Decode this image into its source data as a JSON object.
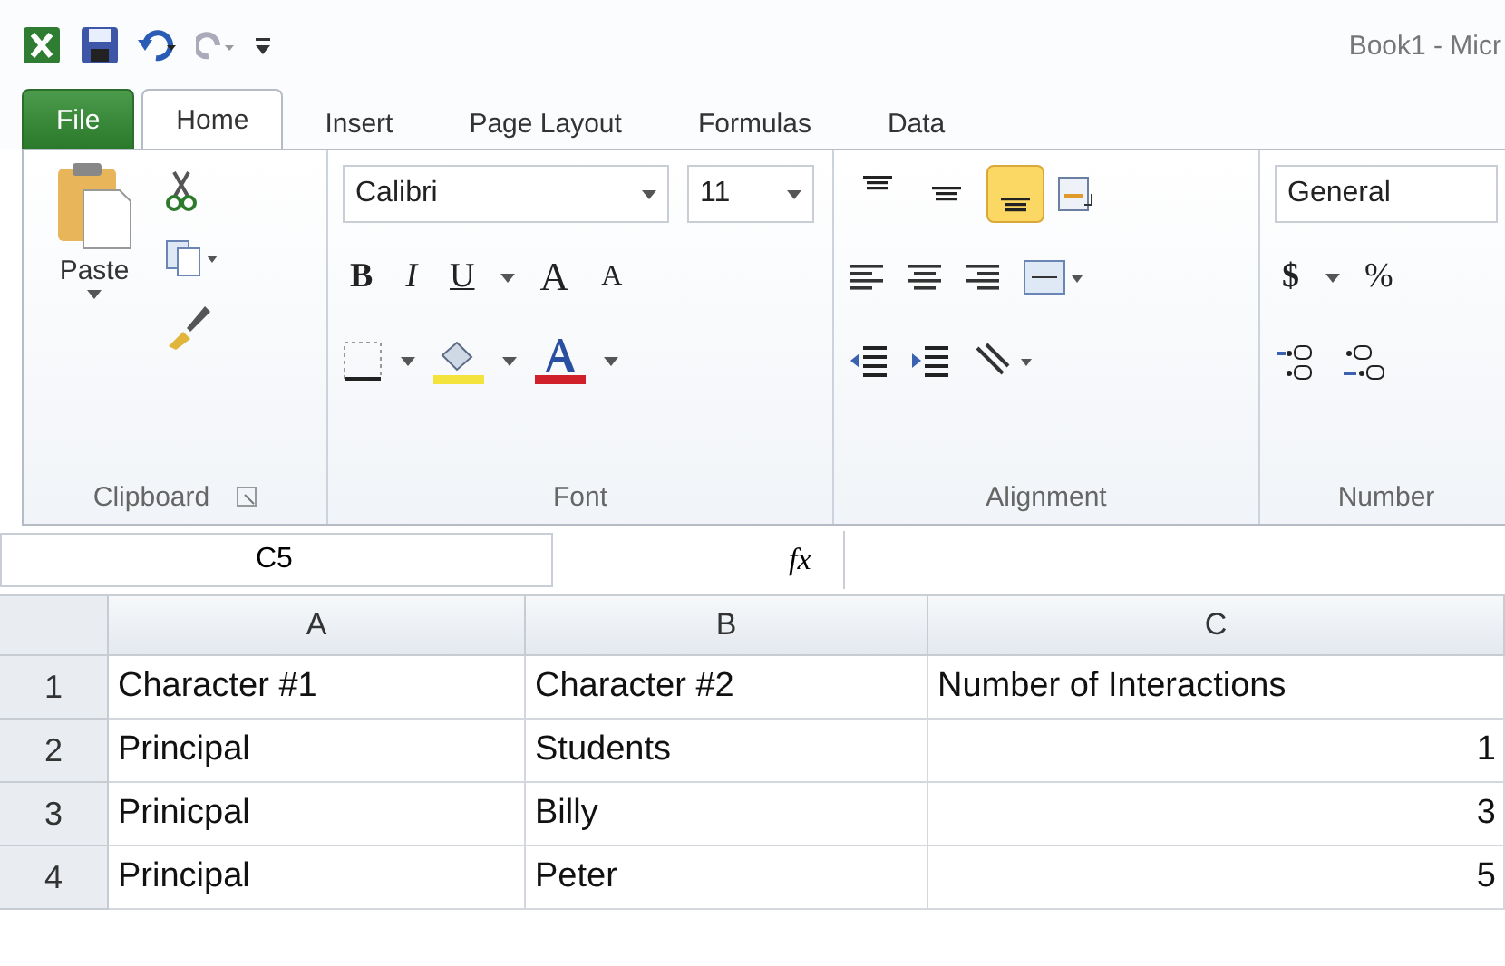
{
  "window": {
    "title": "Book1 - Micr"
  },
  "tabs": [
    {
      "label": "File",
      "kind": "file",
      "selected": false
    },
    {
      "label": "Home",
      "kind": "tab",
      "selected": true
    },
    {
      "label": "Insert",
      "kind": "tab",
      "selected": false
    },
    {
      "label": "Page Layout",
      "kind": "tab",
      "selected": false
    },
    {
      "label": "Formulas",
      "kind": "tab",
      "selected": false
    },
    {
      "label": "Data",
      "kind": "tab",
      "selected": false
    }
  ],
  "ribbon": {
    "clipboard": {
      "label": "Clipboard",
      "paste": "Paste"
    },
    "font": {
      "label": "Font",
      "name": "Calibri",
      "size": "11",
      "bold": "B",
      "italic": "I",
      "underline": "U",
      "grow": "A",
      "shrink": "A"
    },
    "alignment": {
      "label": "Alignment",
      "vertical": [
        {
          "kind": "top",
          "selected": false
        },
        {
          "kind": "middle",
          "selected": false
        },
        {
          "kind": "bottom",
          "selected": true
        }
      ]
    },
    "number": {
      "label": "Number",
      "format": "General",
      "currency": "$",
      "percent": "%"
    }
  },
  "formula_bar": {
    "name_box": "C5",
    "fx": "fx"
  },
  "sheet": {
    "columns": [
      "A",
      "B",
      "C"
    ],
    "rows": [
      {
        "number": "1",
        "cells": [
          "Character #1",
          "Character #2",
          "Number of Interactions"
        ]
      },
      {
        "number": "2",
        "cells": [
          "Principal",
          "Students",
          "1"
        ]
      },
      {
        "number": "3",
        "cells": [
          "Prinicpal",
          "Billy",
          "3"
        ]
      },
      {
        "number": "4",
        "cells": [
          "Principal",
          "Peter",
          "5"
        ]
      }
    ]
  }
}
